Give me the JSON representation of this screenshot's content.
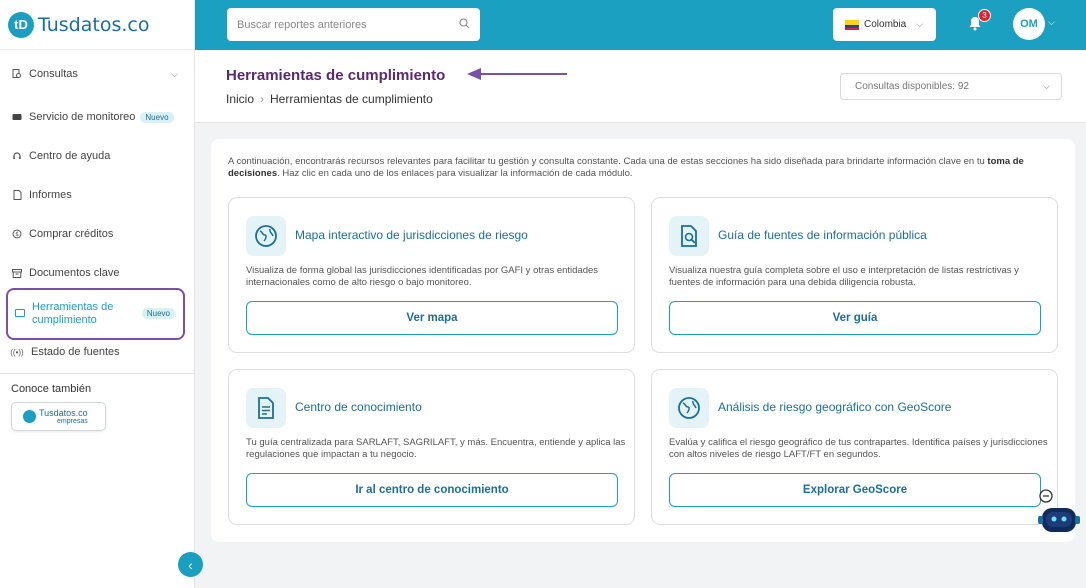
{
  "app": {
    "logo_text": "Tusdatos.co",
    "logo_mark": "tD"
  },
  "sidebar": {
    "items": [
      {
        "label": "Consultas",
        "icon": "search-doc-icon"
      },
      {
        "label": "Servicio de monitoreo",
        "badge": "Nuevo",
        "icon": "monitor-icon"
      },
      {
        "label": "Centro de ayuda",
        "icon": "headset-icon"
      },
      {
        "label": "Informes",
        "icon": "file-icon"
      },
      {
        "label": "Comprar créditos",
        "icon": "coin-icon"
      },
      {
        "label": "Documentos clave",
        "icon": "archive-icon"
      },
      {
        "label": "Herramientas de cumplimiento",
        "badge": "Nuevo",
        "icon": "folder-icon",
        "active": true
      },
      {
        "label": "Estado de fuentes",
        "icon": "broadcast-icon"
      }
    ],
    "conoce_label": "Conoce también",
    "empresas_logo": {
      "name": "Tusdatos.co",
      "sub": "empresas"
    },
    "collapse_icon": "‹"
  },
  "topbar": {
    "search_placeholder": "Buscar reportes anteriores",
    "country": "Colombia",
    "notifications_count": "3",
    "avatar_initials": "OM",
    "accent_color": "#1ba0c2"
  },
  "header": {
    "title": "Herramientas de cumplimiento",
    "breadcrumb": [
      "Inicio",
      "Herramientas de cumplimiento"
    ],
    "credits_label": "Consultas disponibles: 92"
  },
  "main": {
    "intro_part1": "A continuación, encontrarás recursos relevantes para facilitar tu gestión y consulta constante. Cada una de estas secciones ha sido diseñada para brindarte información clave en tu ",
    "intro_bold": "toma de decisiones",
    "intro_part2": ". Haz clic en cada uno de los enlaces para visualizar la información de cada módulo.",
    "tools": [
      {
        "title": "Mapa interactivo de jurisdicciones de riesgo",
        "description": "Visualiza de forma global las jurisdicciones identificadas por GAFI y otras entidades internacionales como de alto riesgo o bajo monitoreo.",
        "button": "Ver mapa",
        "icon": "globe-icon"
      },
      {
        "title": "Guía de fuentes de información pública",
        "description": "Visualiza nuestra guía completa sobre el uso e interpretación de listas restrictivas y fuentes de información para una debida diligencia robusta.",
        "button": "Ver guía",
        "icon": "document-search-icon"
      },
      {
        "title": "Centro de conocimiento",
        "description": "Tu guía centralizada para SARLAFT, SAGRILAFT, y más. Encuentra, entiende y aplica las regulaciones que impactan a tu negocio.",
        "button": "Ir al centro de conocimiento",
        "icon": "document-icon"
      },
      {
        "title": "Análisis de riesgo geográfico con GeoScore",
        "description": "Evalúa y califica el riesgo geográfico de tus contrapartes. Identifica países y jurisdicciones con altos niveles de riesgo LAFT/FT en segundos.",
        "button": "Explorar GeoScore",
        "icon": "globe-icon"
      }
    ]
  }
}
